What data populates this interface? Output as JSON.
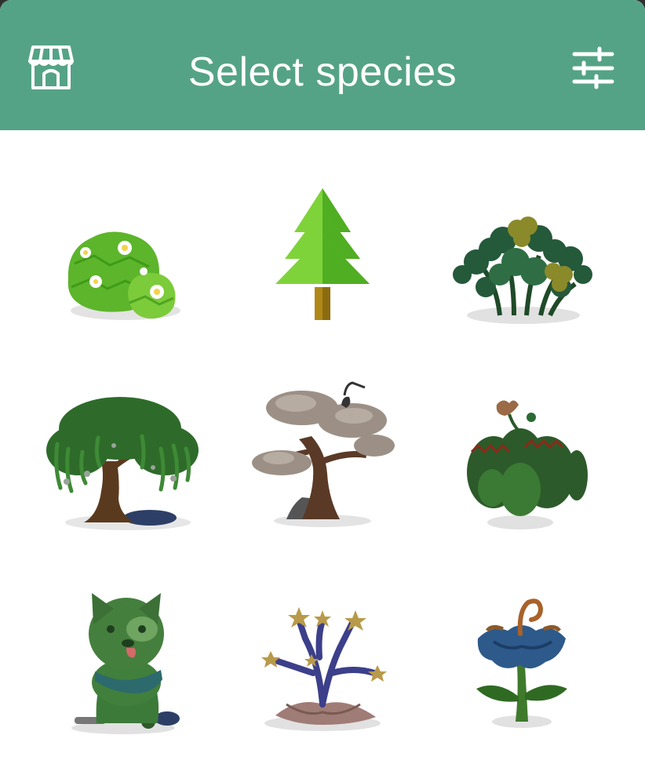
{
  "header": {
    "title": "Select species",
    "store_icon": "store-icon",
    "filter_icon": "sliders-icon"
  },
  "colors": {
    "header_bg": "#55a386",
    "title_text": "#ffffff",
    "panel_bg": "#ffffff"
  },
  "species": [
    {
      "name": "flowering-bush-species",
      "icon": "flowering-bush-icon"
    },
    {
      "name": "pine-tree-species",
      "icon": "pine-tree-icon"
    },
    {
      "name": "clover-bush-species",
      "icon": "clover-bush-icon"
    },
    {
      "name": "willow-tree-species",
      "icon": "willow-tree-icon"
    },
    {
      "name": "bonsai-crane-tree-species",
      "icon": "bonsai-tree-icon"
    },
    {
      "name": "carnivorous-plant-species",
      "icon": "carnivorous-plant-icon"
    },
    {
      "name": "dog-topiary-species",
      "icon": "dog-topiary-icon"
    },
    {
      "name": "star-coral-species",
      "icon": "star-coral-icon"
    },
    {
      "name": "blue-flower-species",
      "icon": "blue-flower-icon"
    }
  ]
}
